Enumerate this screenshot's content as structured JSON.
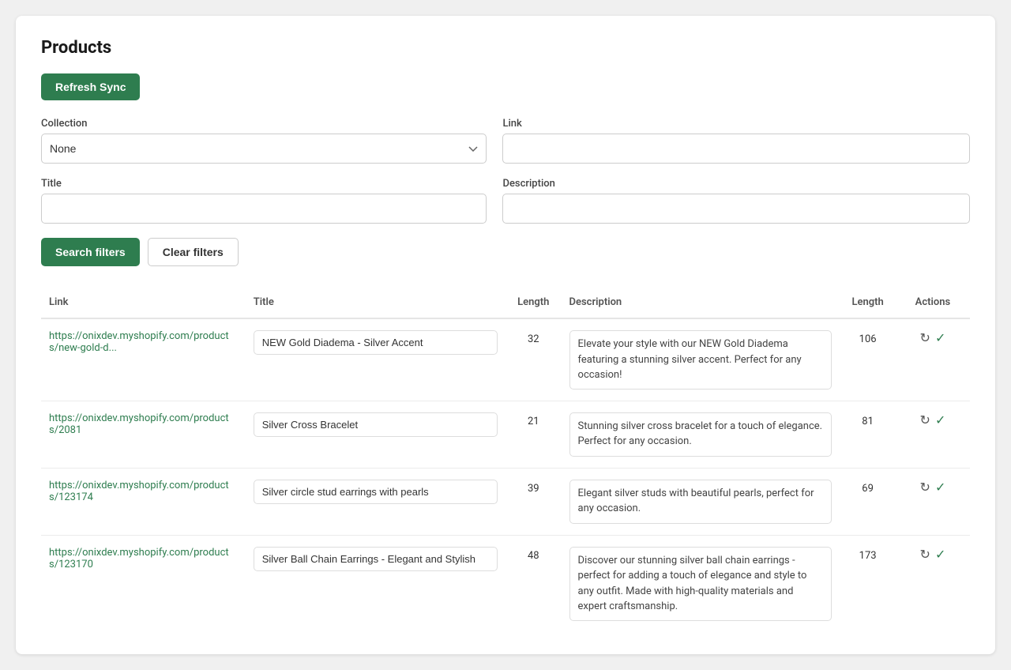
{
  "page": {
    "title": "Products"
  },
  "buttons": {
    "refresh_sync": "Refresh Sync",
    "search_filters": "Search filters",
    "clear_filters": "Clear filters"
  },
  "filters": {
    "collection_label": "Collection",
    "collection_value": "None",
    "collection_options": [
      "None"
    ],
    "link_label": "Link",
    "link_value": "",
    "link_placeholder": "",
    "title_label": "Title",
    "title_value": "",
    "title_placeholder": "",
    "description_label": "Description",
    "description_value": "",
    "description_placeholder": ""
  },
  "table": {
    "columns": {
      "link": "Link",
      "title": "Title",
      "length1": "Length",
      "description": "Description",
      "length2": "Length",
      "actions": "Actions"
    },
    "rows": [
      {
        "link_href": "https://onixdev.myshopify.com/products/new-gold-d...",
        "link_display": "https://onixdev.myshopify.com/products/new-gold-d...",
        "title": "NEW Gold Diadema - Silver Accent",
        "title_length": "32",
        "description": "Elevate your style with our NEW Gold Diadema featuring a stunning silver accent. Perfect for any occasion!",
        "desc_length": "106"
      },
      {
        "link_href": "https://onixdev.myshopify.com/products/2081",
        "link_display": "https://onixdev.myshopify.com/products/2081",
        "title": "Silver Cross Bracelet",
        "title_length": "21",
        "description": "Stunning silver cross bracelet for a touch of elegance. Perfect for any occasion.",
        "desc_length": "81"
      },
      {
        "link_href": "https://onixdev.myshopify.com/products/123174",
        "link_display": "https://onixdev.myshopify.com/products/123174",
        "title": "Silver circle stud earrings with pearls",
        "title_length": "39",
        "description": "Elegant silver studs with beautiful pearls, perfect for any occasion.",
        "desc_length": "69"
      },
      {
        "link_href": "https://onixdev.myshopify.com/products/123170",
        "link_display": "https://onixdev.myshopify.com/products/123170",
        "title": "Silver Ball Chain Earrings - Elegant and Stylish",
        "title_length": "48",
        "description": "Discover our stunning silver ball chain earrings - perfect for adding a touch of elegance and style to any outfit. Made with high-quality materials and expert craftsmanship.",
        "desc_length": "173"
      }
    ]
  }
}
